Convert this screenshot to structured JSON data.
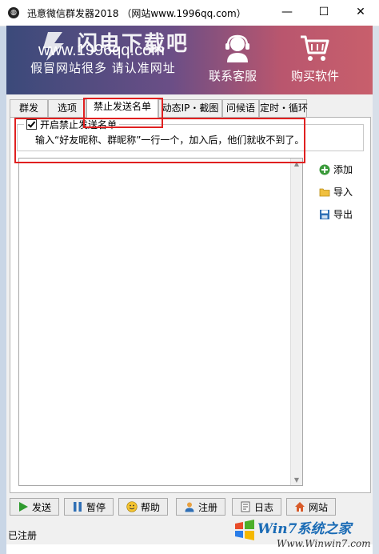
{
  "window": {
    "title": "迅意微信群发器2018 （网站www.1996qq.com）",
    "controls": {
      "minimize": "—",
      "maximize": "☐",
      "close": "✕"
    }
  },
  "banner": {
    "logo_text": "闪电下载吧",
    "site_url": "www.1996qq.com",
    "slogan": "假冒网站很多 请认准网址",
    "service_label": "联系客服",
    "buy_label": "购买软件"
  },
  "tabs": [
    {
      "label": "群发"
    },
    {
      "label": "选项"
    },
    {
      "label": "禁止发送名单"
    },
    {
      "label": "动态IP・截图"
    },
    {
      "label": "问候语"
    },
    {
      "label": "定时・循环"
    }
  ],
  "panel": {
    "checkbox_label": "开启禁止发送名单",
    "description": "输入“好友昵称、群昵称”一行一个，加入后，他们就收不到了。",
    "side_buttons": {
      "add": "添加",
      "import": "导入",
      "export": "导出"
    }
  },
  "toolbar": {
    "send": "发送",
    "pause": "暂停",
    "help": "帮助",
    "register": "注册",
    "log": "日志",
    "website": "网站"
  },
  "status": {
    "text": "已注册"
  },
  "watermark": {
    "line1": "Win7系统之家",
    "line2": "Www.Winwin7.com"
  },
  "colors": {
    "highlight": "#e02020",
    "accent": "#1a6bb5"
  }
}
